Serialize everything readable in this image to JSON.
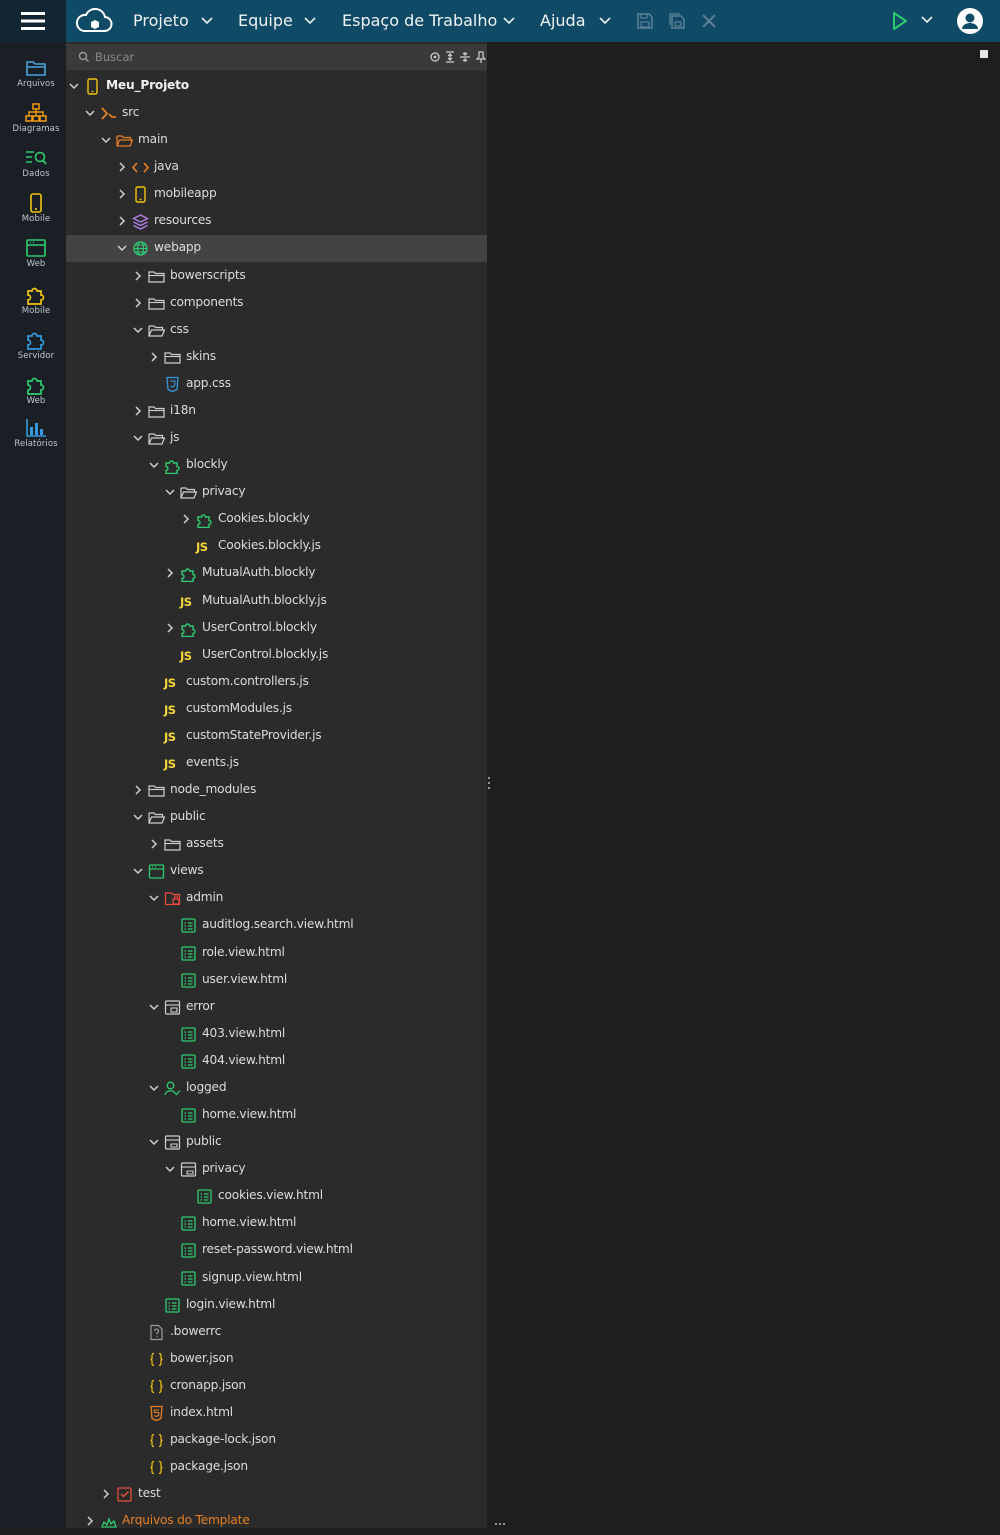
{
  "menu": {
    "items": [
      {
        "label": "Projeto"
      },
      {
        "label": "Equipe"
      },
      {
        "label": "Espaço de Trabalho"
      },
      {
        "label": "Ajuda"
      }
    ]
  },
  "sidebar": {
    "items": [
      {
        "label": "Arquivos",
        "icon": "folder-icon",
        "color": "#4aa3df"
      },
      {
        "label": "Diagramas",
        "icon": "diagram-icon",
        "color": "#f39c12"
      },
      {
        "label": "Dados",
        "icon": "data-search-icon",
        "color": "#2ecc71"
      },
      {
        "label": "Mobile",
        "icon": "mobile-icon",
        "color": "#f1c40f"
      },
      {
        "label": "Web",
        "icon": "web-window-icon",
        "color": "#2ecc71"
      },
      {
        "label": "Mobile",
        "icon": "puzzle-icon",
        "color": "#f1c40f"
      },
      {
        "label": "Servidor",
        "icon": "puzzle-icon",
        "color": "#3498db"
      },
      {
        "label": "Web",
        "icon": "puzzle-icon",
        "color": "#2ecc71"
      },
      {
        "label": "Relatórios",
        "icon": "chart-icon",
        "color": "#3498db"
      }
    ]
  },
  "search": {
    "placeholder": "Buscar"
  },
  "tree": [
    {
      "label": "Meu_Projeto",
      "depth": 0,
      "icon": "mobile-project",
      "tw": "open"
    },
    {
      "label": "src",
      "depth": 1,
      "icon": "src",
      "tw": "open"
    },
    {
      "label": "main",
      "depth": 2,
      "icon": "folder-open-orange",
      "tw": "open"
    },
    {
      "label": "java",
      "depth": 3,
      "icon": "code",
      "tw": "closed"
    },
    {
      "label": "mobileapp",
      "depth": 3,
      "icon": "mobile",
      "tw": "closed"
    },
    {
      "label": "resources",
      "depth": 3,
      "icon": "layers",
      "tw": "closed"
    },
    {
      "label": "webapp",
      "depth": 3,
      "icon": "globe",
      "tw": "open",
      "selected": true
    },
    {
      "label": "bowerscripts",
      "depth": 4,
      "icon": "folder",
      "tw": "closed"
    },
    {
      "label": "components",
      "depth": 4,
      "icon": "folder",
      "tw": "closed"
    },
    {
      "label": "css",
      "depth": 4,
      "icon": "folder-open",
      "tw": "open"
    },
    {
      "label": "skins",
      "depth": 5,
      "icon": "folder",
      "tw": "closed"
    },
    {
      "label": "app.css",
      "depth": 5,
      "icon": "css",
      "tw": "none"
    },
    {
      "label": "i18n",
      "depth": 4,
      "icon": "folder",
      "tw": "closed"
    },
    {
      "label": "js",
      "depth": 4,
      "icon": "folder-open",
      "tw": "open"
    },
    {
      "label": "blockly",
      "depth": 5,
      "icon": "puzzle-green",
      "tw": "open"
    },
    {
      "label": "privacy",
      "depth": 6,
      "icon": "folder-open",
      "tw": "open"
    },
    {
      "label": "Cookies.blockly",
      "depth": 7,
      "icon": "puzzle-green",
      "tw": "closed"
    },
    {
      "label": "Cookies.blockly.js",
      "depth": 7,
      "icon": "js",
      "tw": "none"
    },
    {
      "label": "MutualAuth.blockly",
      "depth": 6,
      "icon": "puzzle-green",
      "tw": "closed"
    },
    {
      "label": "MutualAuth.blockly.js",
      "depth": 6,
      "icon": "js",
      "tw": "none"
    },
    {
      "label": "UserControl.blockly",
      "depth": 6,
      "icon": "puzzle-green",
      "tw": "closed"
    },
    {
      "label": "UserControl.blockly.js",
      "depth": 6,
      "icon": "js",
      "tw": "none"
    },
    {
      "label": "custom.controllers.js",
      "depth": 5,
      "icon": "js",
      "tw": "none"
    },
    {
      "label": "customModules.js",
      "depth": 5,
      "icon": "js",
      "tw": "none"
    },
    {
      "label": "customStateProvider.js",
      "depth": 5,
      "icon": "js",
      "tw": "none"
    },
    {
      "label": "events.js",
      "depth": 5,
      "icon": "js",
      "tw": "none"
    },
    {
      "label": "node_modules",
      "depth": 4,
      "icon": "folder",
      "tw": "closed"
    },
    {
      "label": "public",
      "depth": 4,
      "icon": "folder-open",
      "tw": "open"
    },
    {
      "label": "assets",
      "depth": 5,
      "icon": "folder",
      "tw": "closed"
    },
    {
      "label": "views",
      "depth": 4,
      "icon": "views",
      "tw": "open"
    },
    {
      "label": "admin",
      "depth": 5,
      "icon": "admin",
      "tw": "open"
    },
    {
      "label": "auditlog.search.view.html",
      "depth": 6,
      "icon": "view",
      "tw": "none"
    },
    {
      "label": "role.view.html",
      "depth": 6,
      "icon": "view",
      "tw": "none"
    },
    {
      "label": "user.view.html",
      "depth": 6,
      "icon": "view",
      "tw": "none"
    },
    {
      "label": "error",
      "depth": 5,
      "icon": "error-folder",
      "tw": "open"
    },
    {
      "label": "403.view.html",
      "depth": 6,
      "icon": "view",
      "tw": "none"
    },
    {
      "label": "404.view.html",
      "depth": 6,
      "icon": "view",
      "tw": "none"
    },
    {
      "label": "logged",
      "depth": 5,
      "icon": "logged",
      "tw": "open"
    },
    {
      "label": "home.view.html",
      "depth": 6,
      "icon": "view",
      "tw": "none"
    },
    {
      "label": "public",
      "depth": 5,
      "icon": "public-folder",
      "tw": "open"
    },
    {
      "label": "privacy",
      "depth": 6,
      "icon": "public-folder",
      "tw": "open"
    },
    {
      "label": "cookies.view.html",
      "depth": 7,
      "icon": "view",
      "tw": "none"
    },
    {
      "label": "home.view.html",
      "depth": 6,
      "icon": "view",
      "tw": "none"
    },
    {
      "label": "reset-password.view.html",
      "depth": 6,
      "icon": "view",
      "tw": "none"
    },
    {
      "label": "signup.view.html",
      "depth": 6,
      "icon": "view",
      "tw": "none"
    },
    {
      "label": "login.view.html",
      "depth": 5,
      "icon": "view",
      "tw": "none"
    },
    {
      "label": ".bowerrc",
      "depth": 4,
      "icon": "unknown",
      "tw": "none"
    },
    {
      "label": "bower.json",
      "depth": 4,
      "icon": "json",
      "tw": "none"
    },
    {
      "label": "cronapp.json",
      "depth": 4,
      "icon": "json",
      "tw": "none"
    },
    {
      "label": "index.html",
      "depth": 4,
      "icon": "html5",
      "tw": "none"
    },
    {
      "label": "package-lock.json",
      "depth": 4,
      "icon": "json",
      "tw": "none"
    },
    {
      "label": "package.json",
      "depth": 4,
      "icon": "json",
      "tw": "none"
    },
    {
      "label": "test",
      "depth": 2,
      "icon": "test",
      "tw": "closed"
    },
    {
      "label": "Arquivos do Template",
      "depth": 1,
      "icon": "template",
      "tw": "closed",
      "color": "#e67e22"
    }
  ]
}
